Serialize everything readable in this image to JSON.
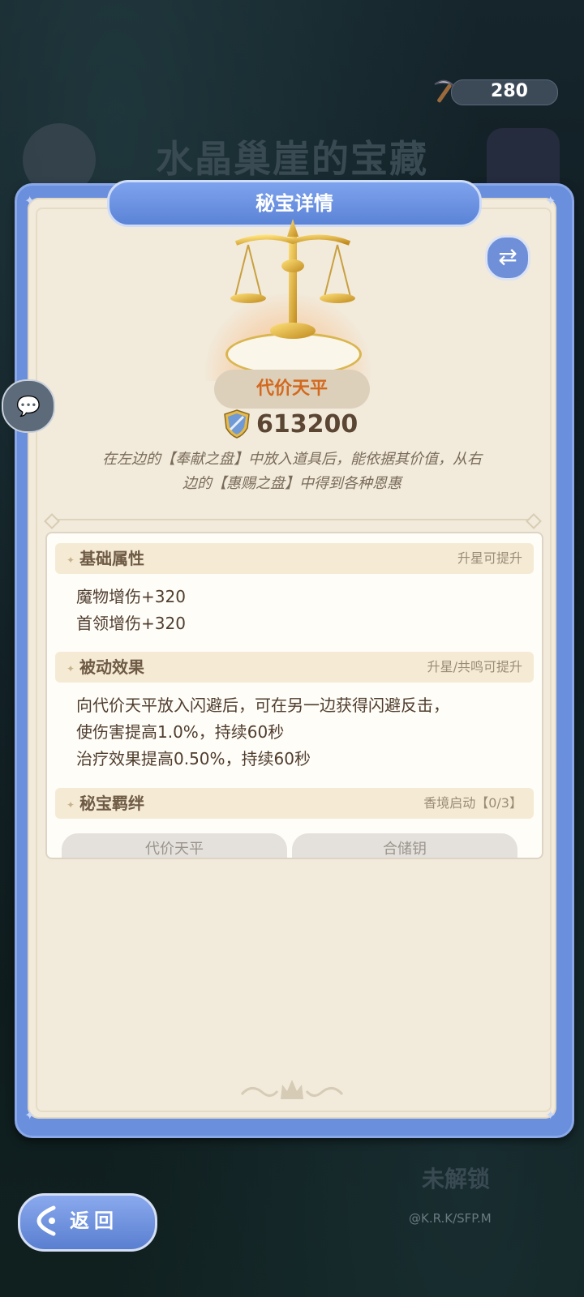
{
  "resource": {
    "icon": "pickaxe-icon",
    "value": "280"
  },
  "background": {
    "title": "水晶巢崖的宝藏",
    "unlock_label": "未解锁",
    "watermark": "@K.R.K/SFP.M"
  },
  "panel": {
    "title": "秘宝详情",
    "item_name": "代价天平",
    "power_icon": "shield-sword-icon",
    "power_value": "613200",
    "description_line1": "在左边的【奉献之盘】中放入道具后，能依据其价值，从右",
    "description_line2": "边的【惠赐之盘】中得到各种恩惠",
    "sections": {
      "base": {
        "title": "基础属性",
        "note": "升星可提升",
        "lines": [
          "魔物增伤+320",
          "首领增伤+320"
        ]
      },
      "passive": {
        "title": "被动效果",
        "note": "升星/共鸣可提升",
        "lines": [
          "向代价天平放入闪避后，可在另一边获得闪避反击，",
          "使伤害提高1.0%，持续60秒",
          "治疗效果提高0.50%，持续60秒"
        ]
      },
      "bond": {
        "title": "秘宝羁绊",
        "note": "香境启动【0/3】",
        "tags": [
          "代价天平",
          "合储钥"
        ]
      }
    }
  },
  "back_button": {
    "label": "返回"
  },
  "colors": {
    "panel_blue": "#6a8fdc",
    "panel_bg": "#f2eadb",
    "item_name": "#d2691e"
  }
}
